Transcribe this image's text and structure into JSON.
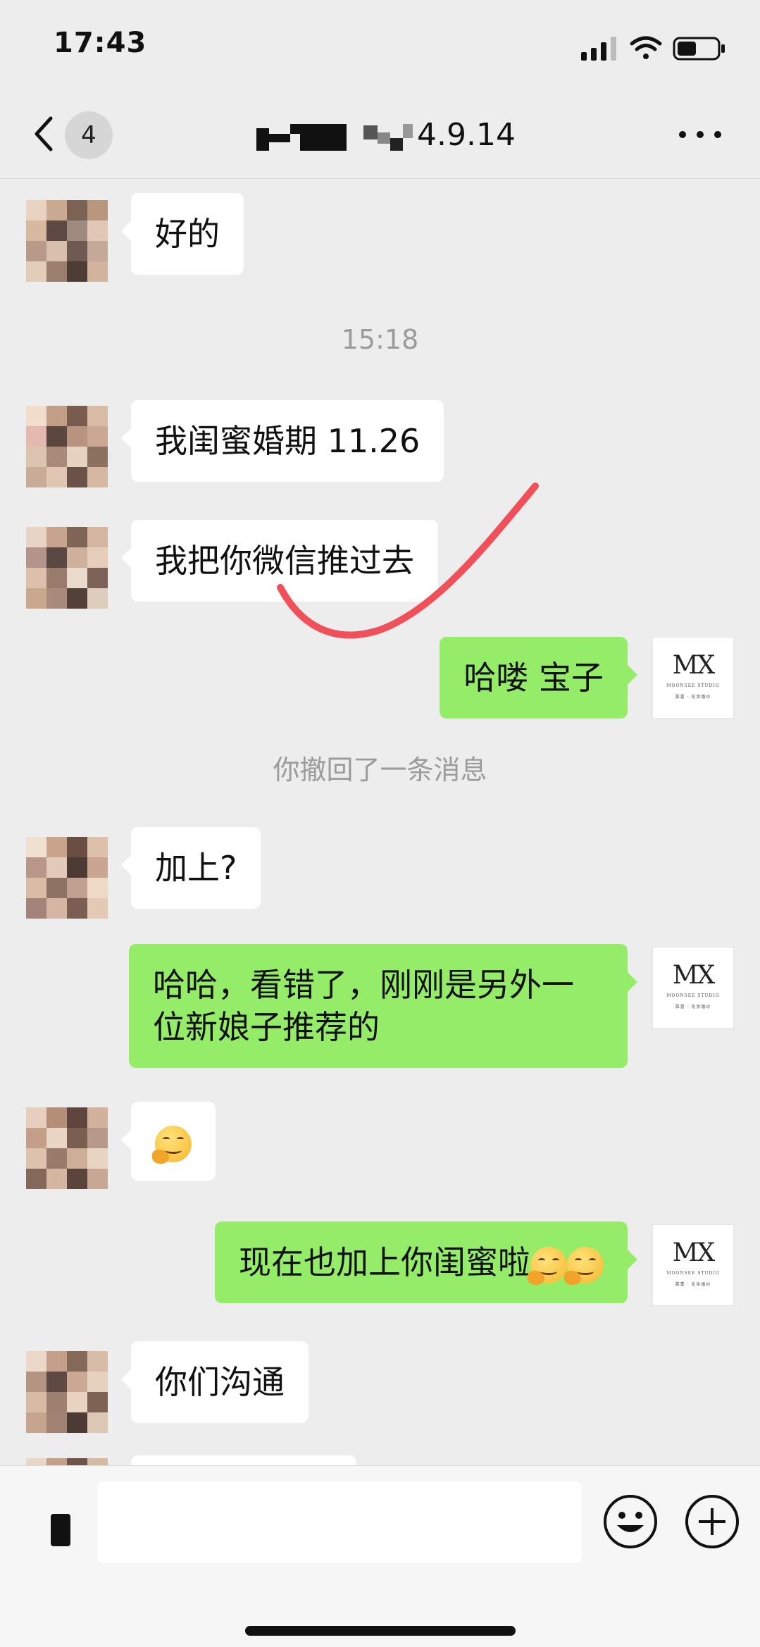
{
  "status_bar": {
    "time": "17:43"
  },
  "nav": {
    "back_icon": "chevron-left-icon",
    "unread_count": "4",
    "title": "4.9.14",
    "more_icon": "more-dots-icon"
  },
  "messages": [
    {
      "side": "in",
      "text": "好的"
    },
    {
      "type": "time",
      "text": "15:18"
    },
    {
      "side": "in",
      "text": "我闺蜜婚期 11.26"
    },
    {
      "side": "in",
      "text": "我把你微信推过去"
    },
    {
      "side": "out",
      "text": "哈喽 宝子"
    },
    {
      "type": "system",
      "text": "你撤回了一条消息"
    },
    {
      "side": "in",
      "text": "加上?"
    },
    {
      "side": "out",
      "text": "哈哈，看错了，刚刚是另外一位新娘子推荐的"
    },
    {
      "side": "in",
      "emoji": "shy-smile-emoji"
    },
    {
      "side": "out",
      "text": "现在也加上你闺蜜啦"
    },
    {
      "side": "in",
      "text": "你们沟通"
    }
  ],
  "studio_avatar": {
    "logo": "MX",
    "name": "MOONSEE STUDIO",
    "tagline": "慕喜 · 化妆婚纱"
  },
  "annotation": {
    "color": "#f0505a",
    "shape": "checkmark-stroke"
  },
  "input_bar": {
    "placeholder": "",
    "voice_icon": "voice-icon",
    "emoji_icon": "smiley-icon",
    "plus_icon": "plus-circle-icon"
  },
  "colors": {
    "out_bubble": "#95ec69",
    "in_bubble": "#ffffff",
    "background": "#ededed"
  }
}
